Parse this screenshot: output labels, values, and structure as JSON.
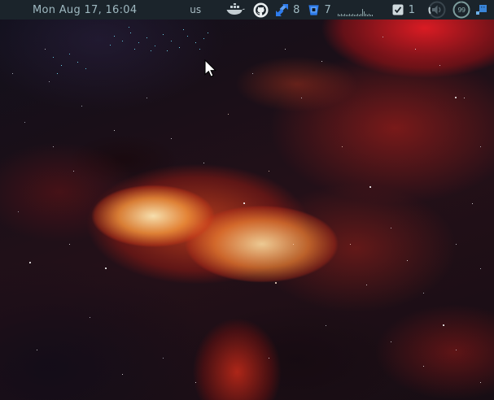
{
  "panel": {
    "clock": "Mon Aug 17, 16:04",
    "keyboard_layout": "us",
    "docker": {
      "icon": "docker-whale-icon"
    },
    "github": {
      "icon": "github-octocat-icon"
    },
    "jira": {
      "icon": "jira-arrows-icon",
      "count": "8"
    },
    "bitbucket": {
      "icon": "bitbucket-bucket-icon",
      "count": "7"
    },
    "cpu_graph": {
      "bars": [
        3,
        2,
        3,
        2,
        3,
        2,
        2,
        3,
        2,
        3,
        2,
        2,
        3,
        2,
        3,
        9,
        6,
        3,
        2,
        3,
        2,
        2
      ]
    },
    "tasks": {
      "icon": "checkbox-checked-icon",
      "count": "1"
    },
    "volume": {
      "icon": "speaker-icon"
    },
    "battery": {
      "percent": "99"
    },
    "tray": {
      "icon": "blue-squares-icon"
    },
    "colors": {
      "panel_bg": "#1b242b",
      "text": "#9fb9c1",
      "icon_blue": "#2e7ced",
      "battery_ring": "#7d9d9d"
    }
  }
}
